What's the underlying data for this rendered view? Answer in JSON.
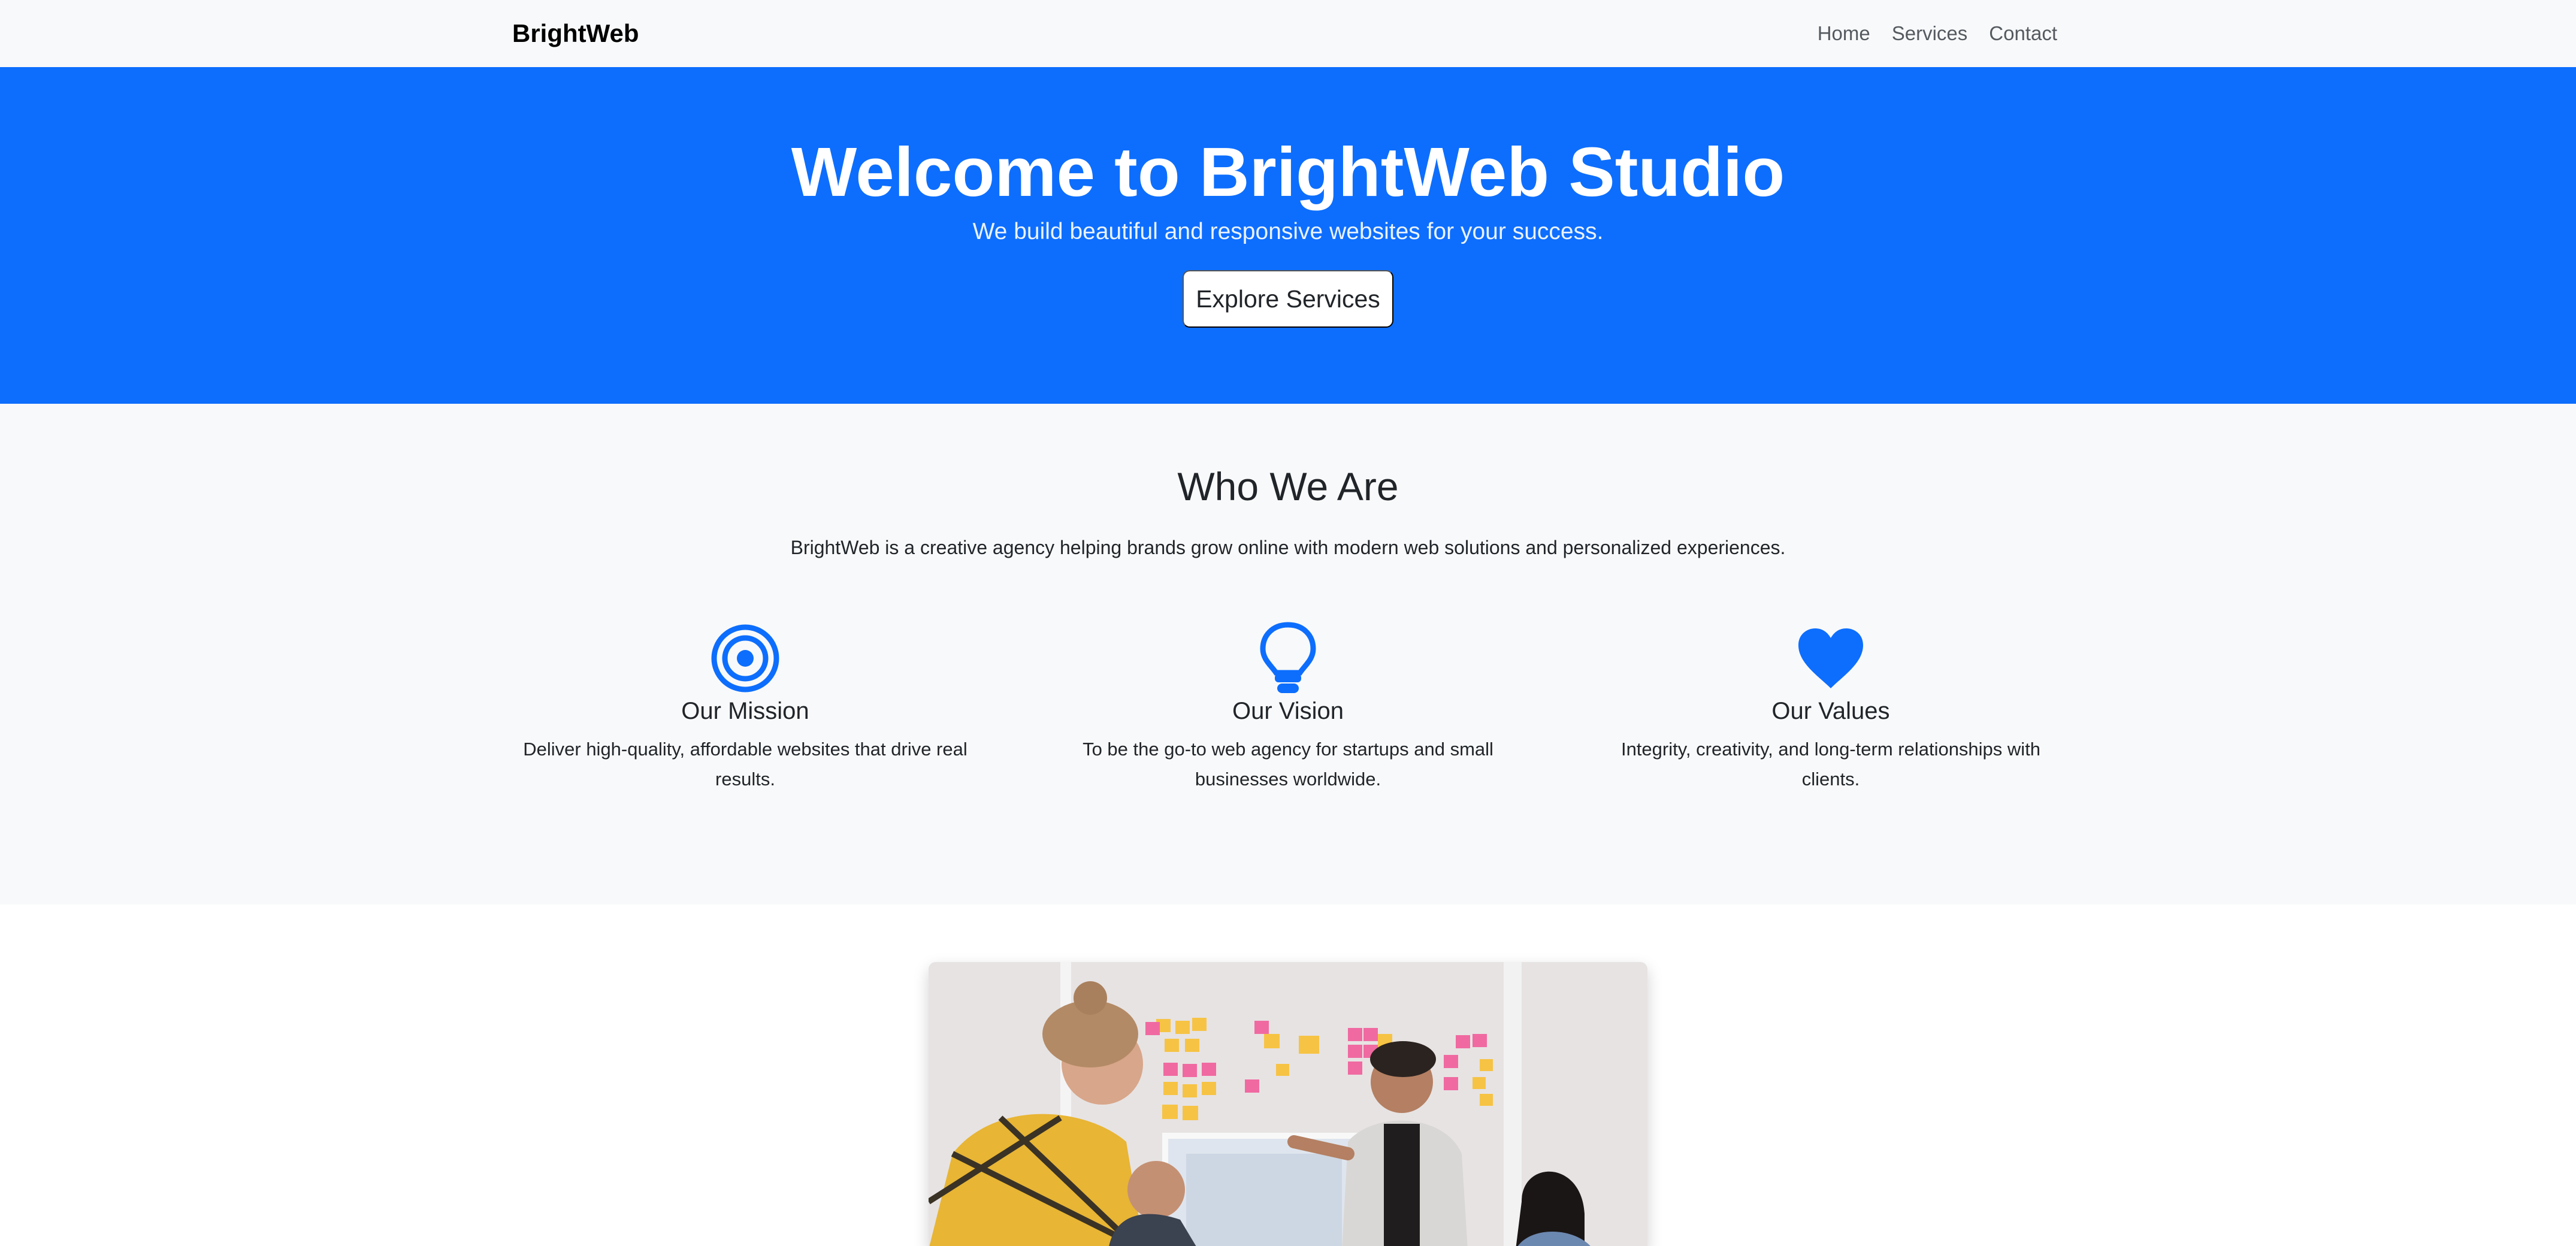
{
  "navbar": {
    "brand": "BrightWeb",
    "links": [
      "Home",
      "Services",
      "Contact"
    ]
  },
  "hero": {
    "title": "Welcome to BrightWeb Studio",
    "subtitle": "We build beautiful and responsive websites for your success.",
    "button_label": "Explore Services"
  },
  "about": {
    "title": "Who We Are",
    "text": "BrightWeb is a creative agency helping brands grow online with modern web solutions and personalized experiences.",
    "features": [
      {
        "icon": "bullseye-icon",
        "title": "Our Mission",
        "description": "Deliver high-quality, affordable websites that drive real results."
      },
      {
        "icon": "lightbulb-icon",
        "title": "Our Vision",
        "description": "To be the go-to web agency for startups and small businesses worldwide."
      },
      {
        "icon": "heart-icon",
        "title": "Our Values",
        "description": "Integrity, creativity, and long-term relationships with clients."
      }
    ]
  },
  "colors": {
    "primary": "#0d6efd",
    "navbar_bg": "#f8f9fa",
    "section_bg": "#f8f9fa"
  }
}
